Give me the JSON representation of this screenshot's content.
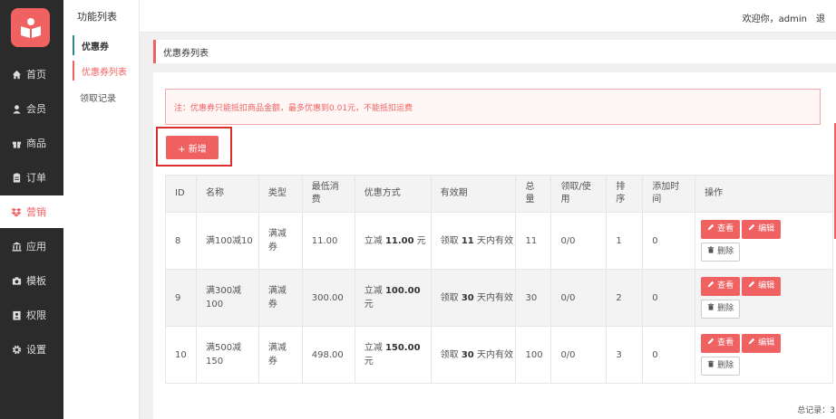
{
  "nav": {
    "items": [
      {
        "label": "首页",
        "icon": "home-icon"
      },
      {
        "label": "会员",
        "icon": "user-icon"
      },
      {
        "label": "商品",
        "icon": "gift-icon"
      },
      {
        "label": "订单",
        "icon": "clipboard-icon"
      },
      {
        "label": "营销",
        "icon": "dropbox-icon"
      },
      {
        "label": "应用",
        "icon": "bank-icon"
      },
      {
        "label": "模板",
        "icon": "camera-icon"
      },
      {
        "label": "权限",
        "icon": "id-card-icon"
      },
      {
        "label": "设置",
        "icon": "gear-icon"
      }
    ],
    "active_index": 4,
    "active_color": "#f06262"
  },
  "subnav": {
    "title": "功能列表",
    "section": "优惠券",
    "items": [
      "优惠券列表",
      "领取记录"
    ]
  },
  "header": {
    "welcome": "欢迎你，admin",
    "trunc": "退"
  },
  "breadcrumb": "优惠券列表",
  "notice": "注：优惠券只能抵扣商品金额，最多优惠到0.01元，不能抵扣运费",
  "add_button": "+ 新增",
  "table": {
    "headers": [
      "ID",
      "名称",
      "类型",
      "最低消\n费",
      "优惠方式",
      "有效期",
      "总\n量",
      "领取/使\n用",
      "排\n序",
      "添加时\n间",
      "操作"
    ],
    "rows": [
      {
        "id": "8",
        "name": "满100减10",
        "type": "满减\n券",
        "min": "11.00",
        "discount_prefix": "立减 ",
        "discount_value": "11.00",
        "discount_suffix": " 元",
        "valid_prefix": "领取 ",
        "valid_days": "11",
        "valid_suffix": " 天内有效",
        "total": "11",
        "used": "0/0",
        "sort": "1",
        "added": "0"
      },
      {
        "id": "9",
        "name": "满300减\n100",
        "type": "满减\n券",
        "min": "300.00",
        "discount_prefix": "立减 ",
        "discount_value": "100.00",
        "discount_suffix": "\n元",
        "valid_prefix": "领取 ",
        "valid_days": "30",
        "valid_suffix": " 天内有效",
        "total": "30",
        "used": "0/0",
        "sort": "2",
        "added": "0"
      },
      {
        "id": "10",
        "name": "满500减\n150",
        "type": "满减\n券",
        "min": "498.00",
        "discount_prefix": "立减 ",
        "discount_value": "150.00",
        "discount_suffix": "\n元",
        "valid_prefix": "领取 ",
        "valid_days": "30",
        "valid_suffix": " 天内有效",
        "total": "100",
        "used": "0/0",
        "sort": "3",
        "added": "0"
      }
    ],
    "actions": {
      "view": "查看",
      "edit": "编辑",
      "delete": "删除"
    }
  },
  "footer": {
    "total": "总记录：3"
  }
}
